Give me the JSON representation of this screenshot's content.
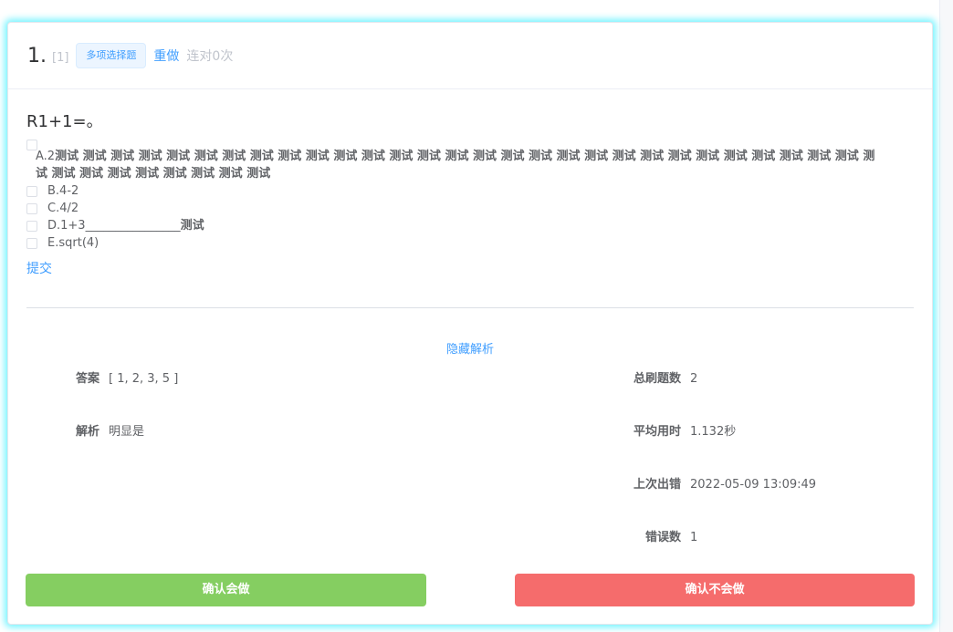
{
  "question": {
    "number": "1.",
    "index": "[1]",
    "type_tag": "多项选择题",
    "redo_label": "重做",
    "streak": "连对0次",
    "stem": "R1+1=。",
    "option_a_prefix": "A.2",
    "option_a_bold": "测试 测试 测试 测试 测试 测试 测试 测试 测试 测试 测试 测试 测试 测试 测试 测试 测试 测试 测试 测试 测试 测试 测试 测试 测试 测试 测试 测试 测试 测试 测试 测试 测试 测试 测试 测试 测试 测试",
    "options": [
      {
        "text": "B.4-2",
        "bold": ""
      },
      {
        "text": "C.4/2",
        "bold": ""
      },
      {
        "text": "D.1+3________________",
        "bold": "测试"
      },
      {
        "text": "E.sqrt(4)",
        "bold": ""
      }
    ],
    "submit_label": "提交"
  },
  "analysis": {
    "toggle_label": "隐藏解析",
    "answer_label": "答案",
    "answer_value": "[ 1, 2, 3, 5 ]",
    "explain_label": "解析",
    "explain_value": "明显是",
    "total_label": "总刷题数",
    "total_value": "2",
    "avg_label": "平均用时",
    "avg_value": "1.132秒",
    "last_wrong_label": "上次出错",
    "last_wrong_value": "2022-05-09 13:09:49",
    "wrong_count_label": "错误数",
    "wrong_count_value": "1"
  },
  "actions": {
    "know_label": "确认会做",
    "dont_know_label": "确认不会做"
  },
  "colors": {
    "accent": "#409eff",
    "know": "#85ce61",
    "dont_know": "#f56c6c",
    "glow": "#00eaff"
  }
}
